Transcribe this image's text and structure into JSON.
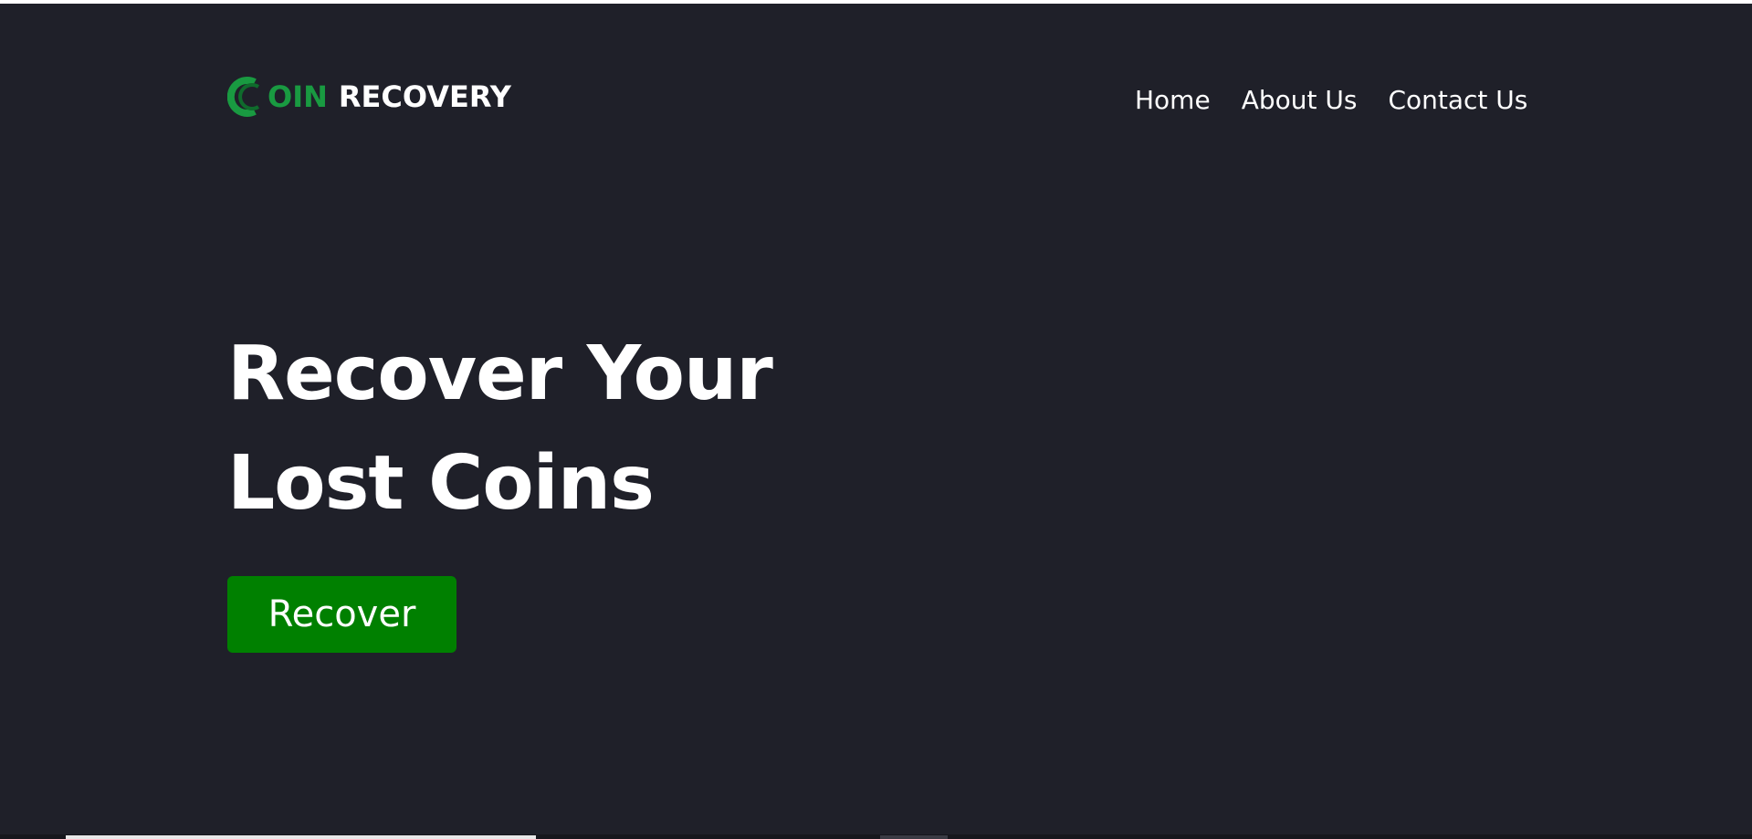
{
  "brand": {
    "logo_green_text": "OIN",
    "logo_white_text": "RECOVERY",
    "accent_color": "#199a41",
    "button_color": "#008000",
    "background_color": "#1f2029"
  },
  "nav": {
    "items": [
      {
        "label": "Home"
      },
      {
        "label": "About Us"
      },
      {
        "label": "Contact Us"
      }
    ]
  },
  "hero": {
    "title_line1": "Recover Your",
    "title_line2": "Lost Coins",
    "cta_label": "Recover"
  },
  "icons": {
    "logo_mark": "coin-c-icon"
  }
}
